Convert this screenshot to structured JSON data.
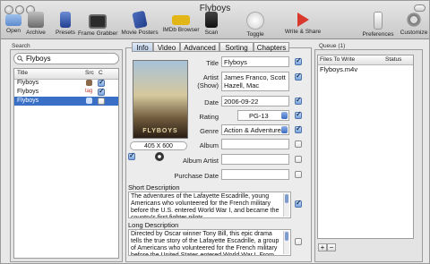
{
  "window": {
    "title": "Flyboys"
  },
  "toolbar": {
    "open": "Open",
    "archive": "Archive",
    "presets": "Presets",
    "frame_grabber": "Frame Grabber",
    "movie_posters": "Movie Posters",
    "imdb_browser": "IMDb Browser",
    "scan": "Scan",
    "toggle": "Toggle",
    "write_share": "Write & Share",
    "preferences": "Preferences",
    "customize": "Customize"
  },
  "search": {
    "panel_title": "Search",
    "query": "Flyboys",
    "columns": {
      "title": "Title",
      "src": "Src",
      "c": "C"
    },
    "rows": [
      {
        "title": "Flyboys",
        "checked": true
      },
      {
        "title": "Flyboys",
        "checked": true
      },
      {
        "title": "Flyboys",
        "checked": false
      }
    ]
  },
  "tabs": [
    "Info",
    "Video",
    "Advanced",
    "Sorting",
    "Chapters"
  ],
  "info": {
    "title_label": "Title",
    "title_value": "Flyboys",
    "artist_label": "Artist",
    "artist_sub": "(Show)",
    "artist_value": "James Franco, Scott Hazell, Mac",
    "date_label": "Date",
    "date_value": "2006-09-22",
    "rating_label": "Rating",
    "rating_value": "PG-13",
    "genre_label": "Genre",
    "genre_value": "Action & Adventure",
    "album_label": "Album",
    "album_artist_label": "Album Artist",
    "purchase_date_label": "Purchase Date",
    "poster_size": "405 X 600",
    "short_desc_label": "Short Description",
    "short_desc_value": "The adventures of the Lafayette Escadrille, young Americans who volunteered for the French military before the U.S. entered World War I, and became the country's first fighter pilots.",
    "long_desc_label": "Long Description",
    "long_desc_value": "Directed by Oscar winner Tony Bill, this epic drama tells the true story of the Lafayette Escadrille, a group of Americans who volunteered for the French military before the United States entered World War I. From boy Pilots"
  },
  "queue": {
    "panel_title": "Queue (1)",
    "col_files": "Files To Write",
    "col_status": "Status",
    "items": [
      {
        "file": "Flyboys.m4v",
        "status": ""
      }
    ],
    "add": "+",
    "remove": "−"
  },
  "colors": {
    "selection": "#3a6fc8",
    "write_share": "#d9382c"
  }
}
